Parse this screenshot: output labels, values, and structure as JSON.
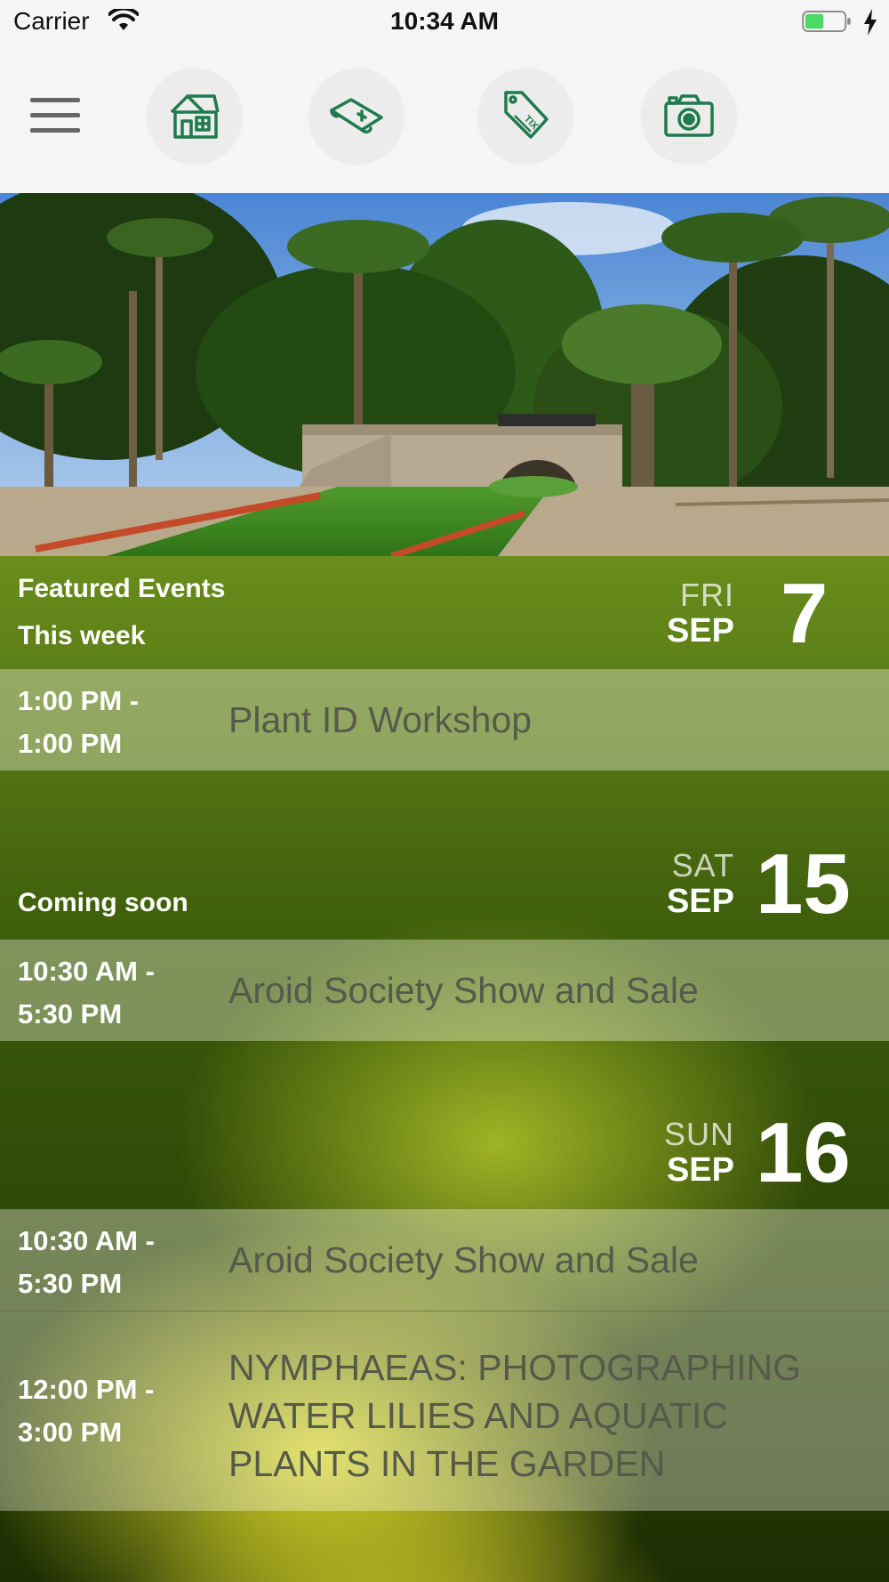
{
  "status_bar": {
    "carrier": "Carrier",
    "time": "10:34 AM",
    "battery_color": "#4cd964"
  },
  "toolbar": {
    "icon_color": "#1f7a4c",
    "buttons": [
      {
        "icon": "menu-icon"
      },
      {
        "icon": "house-icon"
      },
      {
        "icon": "map-icon"
      },
      {
        "icon": "ticket-icon"
      },
      {
        "icon": "camera-icon"
      }
    ]
  },
  "featured": {
    "title": "Featured Events",
    "subtitle": "This week"
  },
  "days": [
    {
      "label": "",
      "dow": "FRI",
      "month": "SEP",
      "day": "7",
      "events": [
        {
          "time": "1:00 PM -\n1:00 PM",
          "title": "Plant ID Workshop"
        }
      ]
    },
    {
      "label": "Coming soon",
      "dow": "SAT",
      "month": "SEP",
      "day": "15",
      "events": [
        {
          "time": "10:30 AM -\n5:30 PM",
          "title": "Aroid Society Show and Sale"
        }
      ]
    },
    {
      "label": "",
      "dow": "SUN",
      "month": "SEP",
      "day": "16",
      "events": [
        {
          "time": "10:30 AM -\n5:30 PM",
          "title": "Aroid Society Show and Sale"
        },
        {
          "time": "12:00 PM -\n3:00 PM",
          "title": "NYMPHAEAS: PHOTOGRAPHING WATER LILIES AND AQUATIC PLANTS IN THE GARDEN"
        }
      ]
    }
  ]
}
